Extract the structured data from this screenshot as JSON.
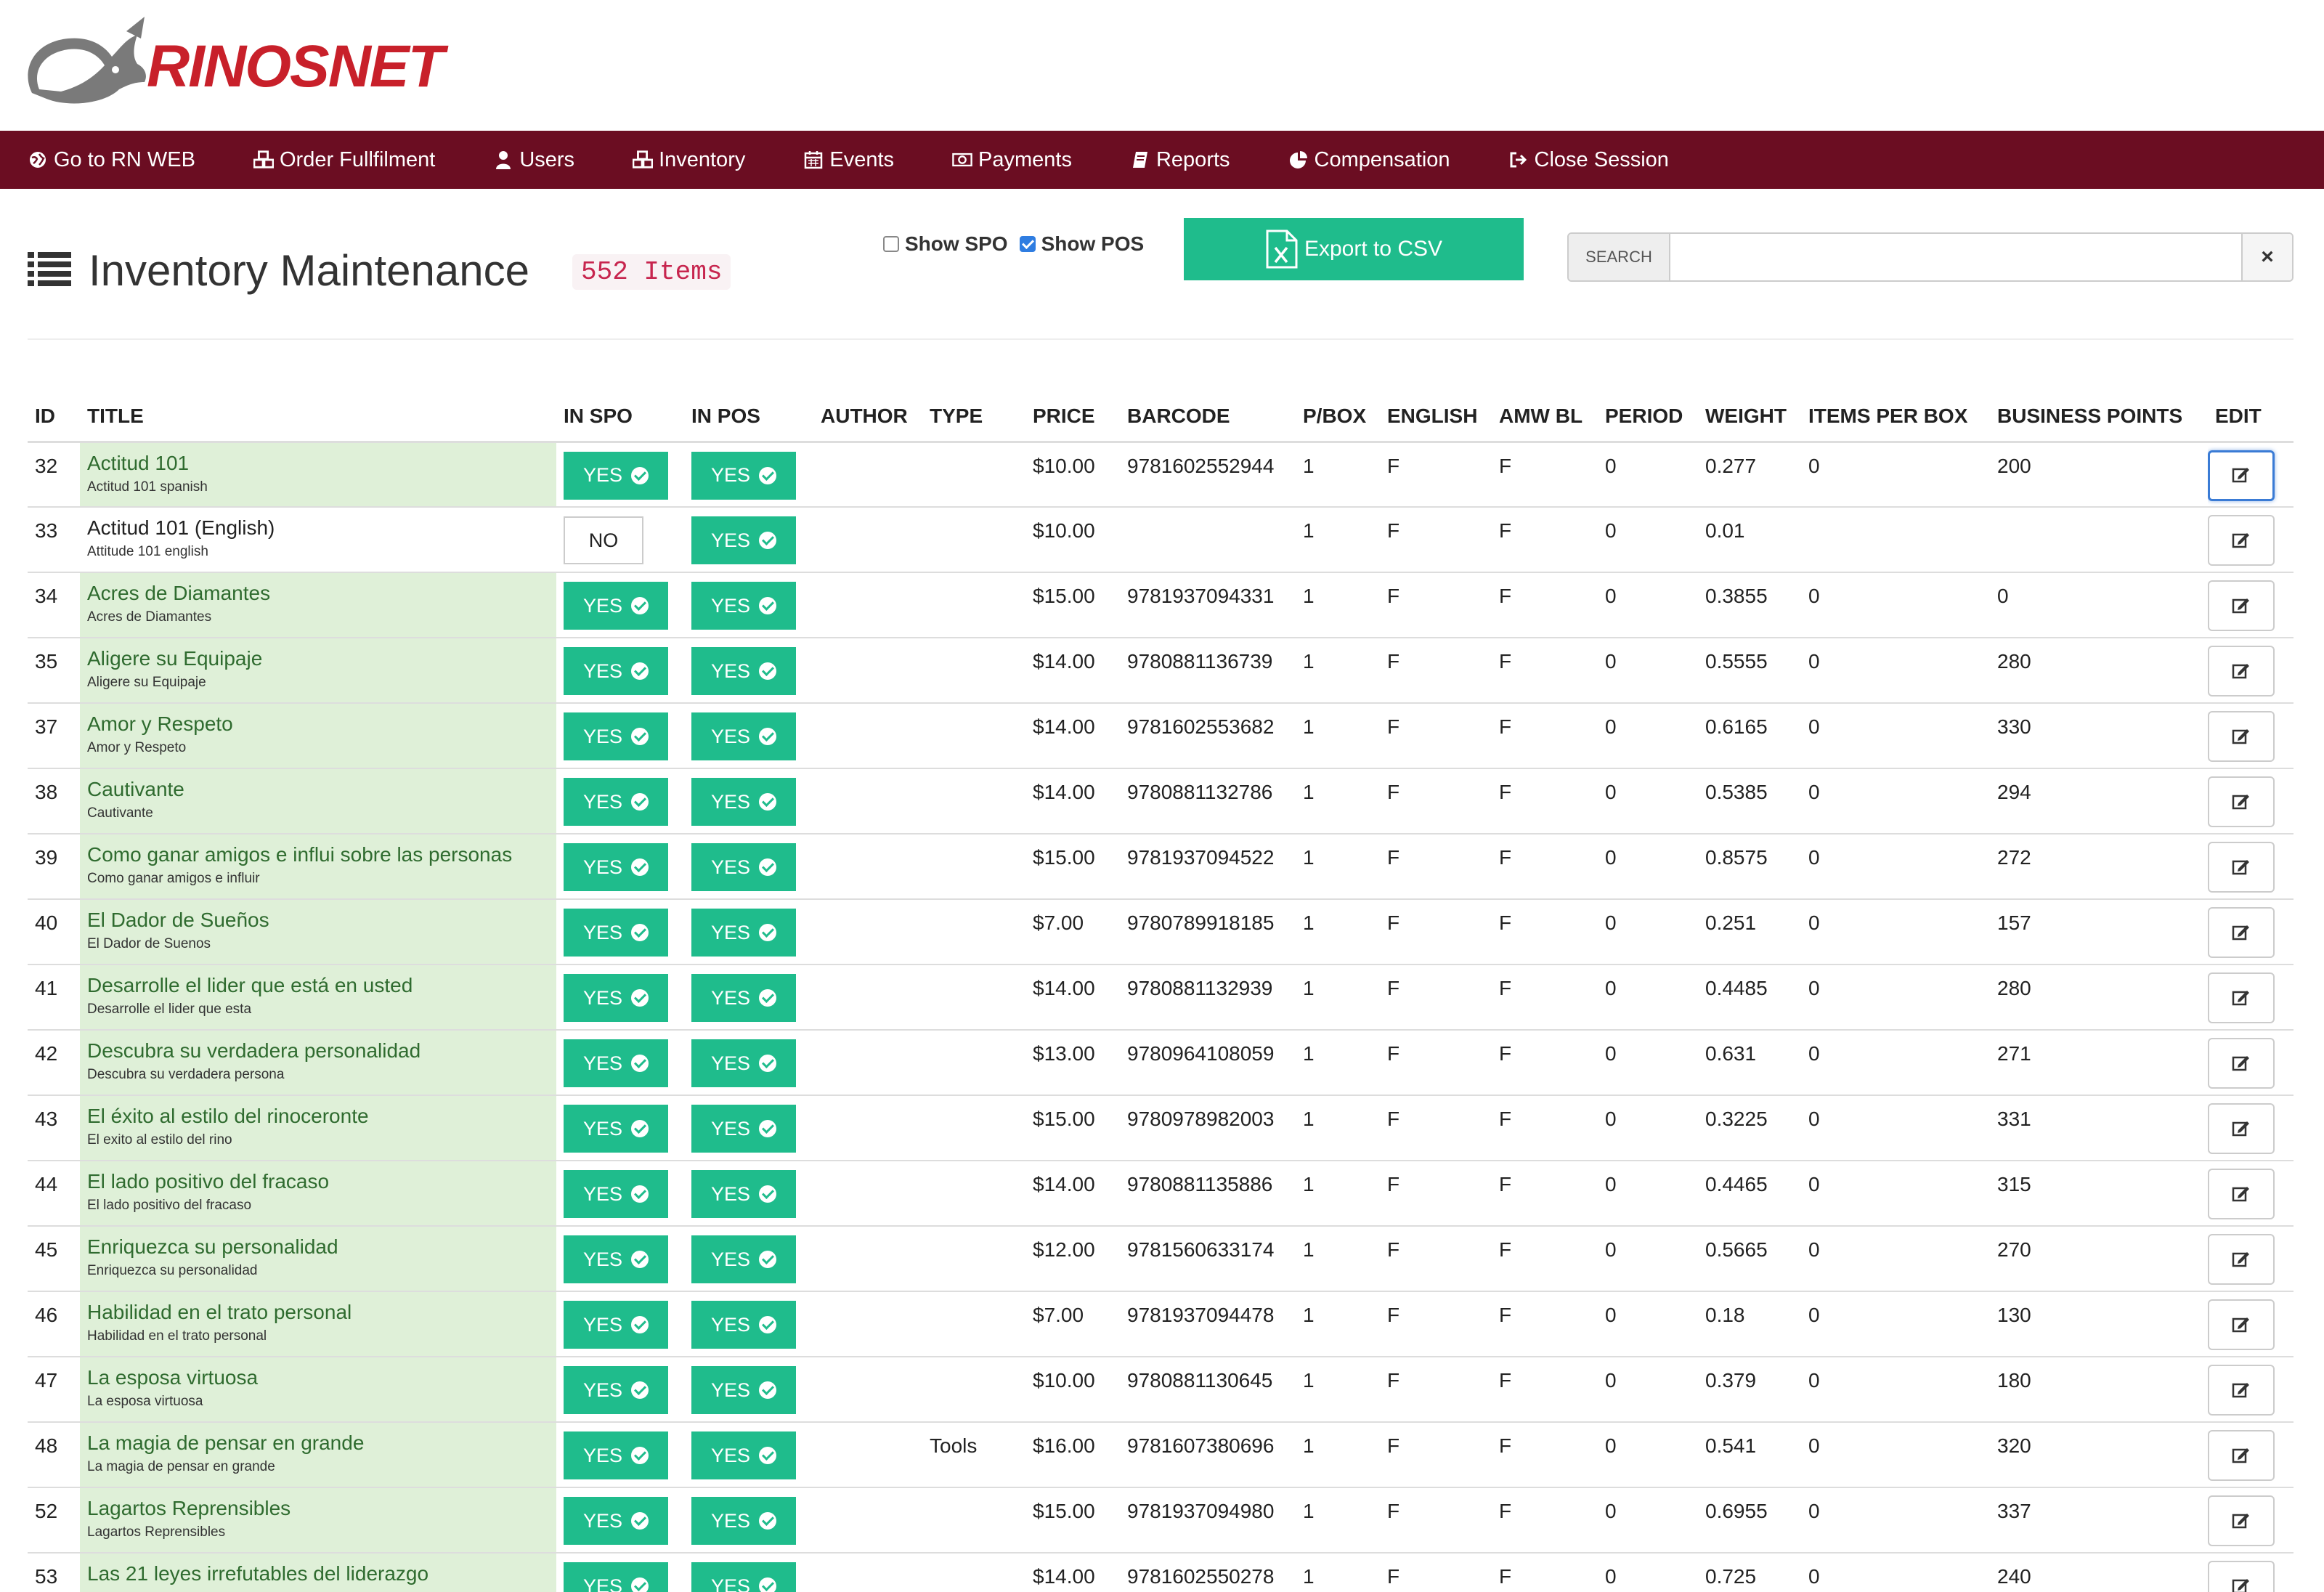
{
  "brand": {
    "name": "RINOSNET"
  },
  "nav": [
    {
      "label": "Go to RN WEB",
      "icon": "globe-icon"
    },
    {
      "label": "Order Fullfilment",
      "icon": "cubes-icon"
    },
    {
      "label": "Users",
      "icon": "user-icon"
    },
    {
      "label": "Inventory",
      "icon": "cubes-icon"
    },
    {
      "label": "Events",
      "icon": "calendar-icon"
    },
    {
      "label": "Payments",
      "icon": "money-icon"
    },
    {
      "label": "Reports",
      "icon": "book-icon"
    },
    {
      "label": "Compensation",
      "icon": "pie-chart-icon"
    },
    {
      "label": "Close Session",
      "icon": "sign-out-icon"
    }
  ],
  "page": {
    "title": "Inventory Maintenance",
    "count": "552 Items",
    "show_spo_label": "Show SPO",
    "show_spo_checked": false,
    "show_pos_label": "Show POS",
    "show_pos_checked": true,
    "export_label": "Export to CSV",
    "search_label": "SEARCH",
    "search_value": "",
    "clear_label": "×"
  },
  "table": {
    "columns": [
      "ID",
      "TITLE",
      "IN SPO",
      "IN POS",
      "AUTHOR",
      "TYPE",
      "PRICE",
      "BARCODE",
      "P/BOX",
      "ENGLISH",
      "AMW BL",
      "PERIOD",
      "WEIGHT",
      "ITEMS PER BOX",
      "BUSINESS POINTS",
      "EDIT"
    ],
    "rows": [
      {
        "id": "32",
        "title": "Actitud 101",
        "subtitle": "Actitud 101 spanish",
        "spo": "YES",
        "pos": "YES",
        "author": "",
        "type": "",
        "price": "$10.00",
        "barcode": "9781602552944",
        "pbox": "1",
        "english": "F",
        "amwbl": "F",
        "period": "0",
        "weight": "0.277",
        "ipb": "0",
        "bp": "200",
        "highlight": true
      },
      {
        "id": "33",
        "title": "Actitud 101 (English)",
        "subtitle": "Attitude 101 english",
        "spo": "NO",
        "pos": "YES",
        "author": "",
        "type": "",
        "price": "$10.00",
        "barcode": "",
        "pbox": "1",
        "english": "F",
        "amwbl": "F",
        "period": "0",
        "weight": "0.01",
        "ipb": "",
        "bp": "",
        "highlight": false
      },
      {
        "id": "34",
        "title": "Acres de Diamantes",
        "subtitle": "Acres de Diamantes",
        "spo": "YES",
        "pos": "YES",
        "author": "",
        "type": "",
        "price": "$15.00",
        "barcode": "9781937094331",
        "pbox": "1",
        "english": "F",
        "amwbl": "F",
        "period": "0",
        "weight": "0.3855",
        "ipb": "0",
        "bp": "0",
        "highlight": true
      },
      {
        "id": "35",
        "title": "Aligere su Equipaje",
        "subtitle": "Aligere su Equipaje",
        "spo": "YES",
        "pos": "YES",
        "author": "",
        "type": "",
        "price": "$14.00",
        "barcode": "9780881136739",
        "pbox": "1",
        "english": "F",
        "amwbl": "F",
        "period": "0",
        "weight": "0.5555",
        "ipb": "0",
        "bp": "280",
        "highlight": true
      },
      {
        "id": "37",
        "title": "Amor y Respeto",
        "subtitle": "Amor y Respeto",
        "spo": "YES",
        "pos": "YES",
        "author": "",
        "type": "",
        "price": "$14.00",
        "barcode": "9781602553682",
        "pbox": "1",
        "english": "F",
        "amwbl": "F",
        "period": "0",
        "weight": "0.6165",
        "ipb": "0",
        "bp": "330",
        "highlight": true
      },
      {
        "id": "38",
        "title": "Cautivante",
        "subtitle": "Cautivante",
        "spo": "YES",
        "pos": "YES",
        "author": "",
        "type": "",
        "price": "$14.00",
        "barcode": "9780881132786",
        "pbox": "1",
        "english": "F",
        "amwbl": "F",
        "period": "0",
        "weight": "0.5385",
        "ipb": "0",
        "bp": "294",
        "highlight": true
      },
      {
        "id": "39",
        "title": "Como ganar amigos e influi sobre las personas",
        "subtitle": "Como ganar amigos e influir",
        "spo": "YES",
        "pos": "YES",
        "author": "",
        "type": "",
        "price": "$15.00",
        "barcode": "9781937094522",
        "pbox": "1",
        "english": "F",
        "amwbl": "F",
        "period": "0",
        "weight": "0.8575",
        "ipb": "0",
        "bp": "272",
        "highlight": true
      },
      {
        "id": "40",
        "title": "El Dador de Sueños",
        "subtitle": "El Dador de Suenos",
        "spo": "YES",
        "pos": "YES",
        "author": "",
        "type": "",
        "price": "$7.00",
        "barcode": "9780789918185",
        "pbox": "1",
        "english": "F",
        "amwbl": "F",
        "period": "0",
        "weight": "0.251",
        "ipb": "0",
        "bp": "157",
        "highlight": true
      },
      {
        "id": "41",
        "title": "Desarrolle el lider que está en usted",
        "subtitle": "Desarrolle el lider que esta",
        "spo": "YES",
        "pos": "YES",
        "author": "",
        "type": "",
        "price": "$14.00",
        "barcode": "9780881132939",
        "pbox": "1",
        "english": "F",
        "amwbl": "F",
        "period": "0",
        "weight": "0.4485",
        "ipb": "0",
        "bp": "280",
        "highlight": true
      },
      {
        "id": "42",
        "title": "Descubra su verdadera personalidad",
        "subtitle": "Descubra su verdadera persona",
        "spo": "YES",
        "pos": "YES",
        "author": "",
        "type": "",
        "price": "$13.00",
        "barcode": "9780964108059",
        "pbox": "1",
        "english": "F",
        "amwbl": "F",
        "period": "0",
        "weight": "0.631",
        "ipb": "0",
        "bp": "271",
        "highlight": true
      },
      {
        "id": "43",
        "title": "El éxito al estilo del rinoceronte",
        "subtitle": "El exito al estilo del rino",
        "spo": "YES",
        "pos": "YES",
        "author": "",
        "type": "",
        "price": "$15.00",
        "barcode": "9780978982003",
        "pbox": "1",
        "english": "F",
        "amwbl": "F",
        "period": "0",
        "weight": "0.3225",
        "ipb": "0",
        "bp": "331",
        "highlight": true
      },
      {
        "id": "44",
        "title": "El lado positivo del fracaso",
        "subtitle": "El lado positivo del fracaso",
        "spo": "YES",
        "pos": "YES",
        "author": "",
        "type": "",
        "price": "$14.00",
        "barcode": "9780881135886",
        "pbox": "1",
        "english": "F",
        "amwbl": "F",
        "period": "0",
        "weight": "0.4465",
        "ipb": "0",
        "bp": "315",
        "highlight": true
      },
      {
        "id": "45",
        "title": "Enriquezca su personalidad",
        "subtitle": "Enriquezca su personalidad",
        "spo": "YES",
        "pos": "YES",
        "author": "",
        "type": "",
        "price": "$12.00",
        "barcode": "9781560633174",
        "pbox": "1",
        "english": "F",
        "amwbl": "F",
        "period": "0",
        "weight": "0.5665",
        "ipb": "0",
        "bp": "270",
        "highlight": true
      },
      {
        "id": "46",
        "title": "Habilidad en el trato personal",
        "subtitle": "Habilidad en el trato personal",
        "spo": "YES",
        "pos": "YES",
        "author": "",
        "type": "",
        "price": "$7.00",
        "barcode": "9781937094478",
        "pbox": "1",
        "english": "F",
        "amwbl": "F",
        "period": "0",
        "weight": "0.18",
        "ipb": "0",
        "bp": "130",
        "highlight": true
      },
      {
        "id": "47",
        "title": "La esposa virtuosa",
        "subtitle": "La esposa virtuosa",
        "spo": "YES",
        "pos": "YES",
        "author": "",
        "type": "",
        "price": "$10.00",
        "barcode": "9780881130645",
        "pbox": "1",
        "english": "F",
        "amwbl": "F",
        "period": "0",
        "weight": "0.379",
        "ipb": "0",
        "bp": "180",
        "highlight": true
      },
      {
        "id": "48",
        "title": "La magia de pensar en grande",
        "subtitle": "La magia de pensar en grande",
        "spo": "YES",
        "pos": "YES",
        "author": "",
        "type": "Tools",
        "price": "$16.00",
        "barcode": "9781607380696",
        "pbox": "1",
        "english": "F",
        "amwbl": "F",
        "period": "0",
        "weight": "0.541",
        "ipb": "0",
        "bp": "320",
        "highlight": true
      },
      {
        "id": "52",
        "title": "Lagartos Reprensibles",
        "subtitle": "Lagartos Reprensibles",
        "spo": "YES",
        "pos": "YES",
        "author": "",
        "type": "",
        "price": "$15.00",
        "barcode": "9781937094980",
        "pbox": "1",
        "english": "F",
        "amwbl": "F",
        "period": "0",
        "weight": "0.6955",
        "ipb": "0",
        "bp": "337",
        "highlight": true
      },
      {
        "id": "53",
        "title": "Las 21 leyes irrefutables del liderazgo",
        "subtitle": "",
        "spo": "YES",
        "pos": "YES",
        "author": "",
        "type": "",
        "price": "$14.00",
        "barcode": "9781602550278",
        "pbox": "1",
        "english": "F",
        "amwbl": "F",
        "period": "0",
        "weight": "0.725",
        "ipb": "0",
        "bp": "240",
        "highlight": true
      }
    ]
  }
}
